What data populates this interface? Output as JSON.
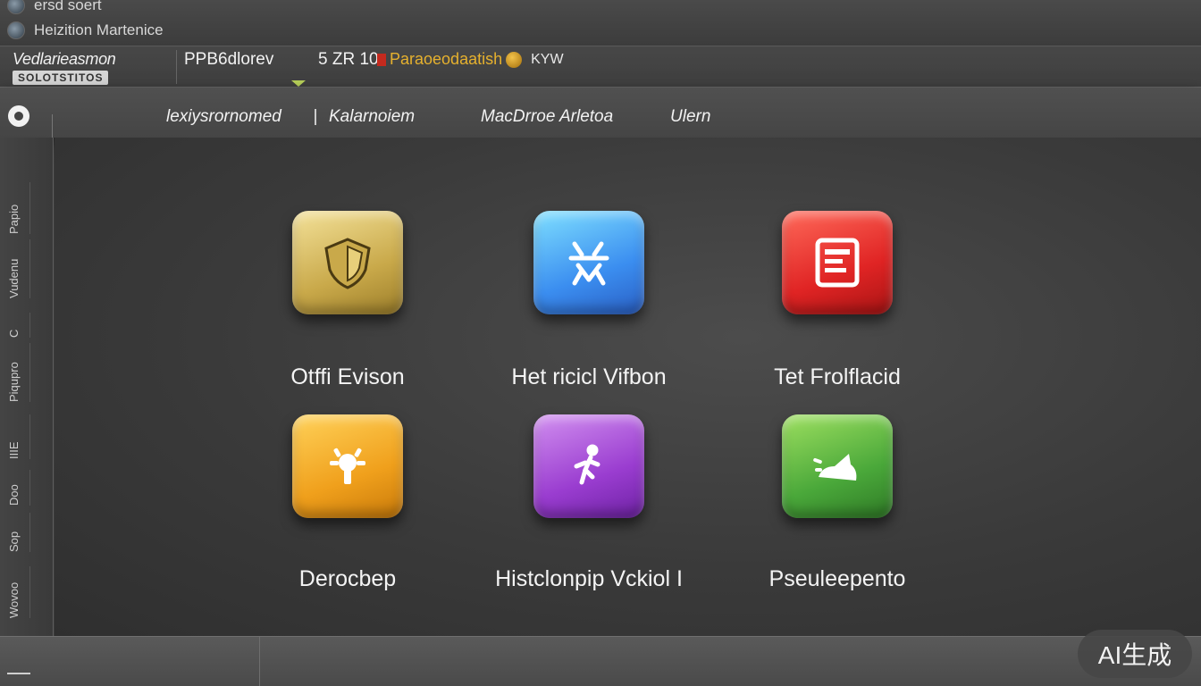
{
  "titlebar": {
    "line1": "ersd soert",
    "line2": "Heizition Martenice"
  },
  "toolbar": {
    "brand_name": "Vedlarieasmon",
    "brand_badge": "SOLOTSTITOS",
    "item1": "PPB6dlorev",
    "item2": "5 ZR 10",
    "status_text": "Paraoeodaatish",
    "status_extra": "KYW"
  },
  "nav": {
    "items": [
      "lexiysrornomed",
      "Kalarnoiem",
      "MacDrroe Arletoa",
      "Ulern"
    ]
  },
  "rail": {
    "items": [
      "Papio",
      "Vudenu",
      "C",
      "Piqupro",
      "IIIE",
      "Doo",
      "Sop",
      "Wovoo"
    ]
  },
  "tiles": [
    {
      "label": "Otffi Evison",
      "icon": "shield-icon",
      "color": "gold"
    },
    {
      "label": "Het ricicl Vifbon",
      "icon": "tools-icon",
      "color": "blue"
    },
    {
      "label": "Tet Frolflacid",
      "icon": "document-icon",
      "color": "red"
    },
    {
      "label": "Derocbep",
      "icon": "bell-icon",
      "color": "orange"
    },
    {
      "label": "Histclonpip Vckiol I",
      "icon": "runner-icon",
      "color": "purple"
    },
    {
      "label": "Pseuleepento",
      "icon": "animal-icon",
      "color": "green"
    }
  ],
  "watermark": "AI生成"
}
